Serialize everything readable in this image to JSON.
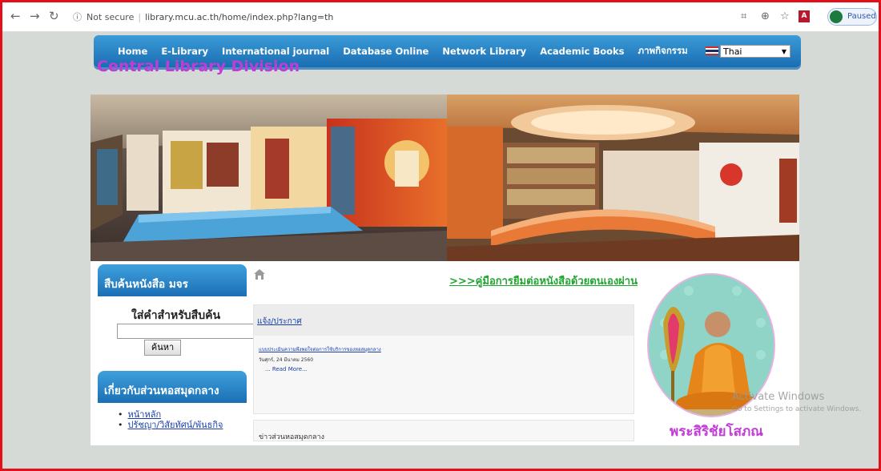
{
  "browser": {
    "url_prefix": "Not secure",
    "url": "library.mcu.ac.th/home/index.php?lang=th",
    "profile_status": "Paused"
  },
  "nav": {
    "items": [
      "Home",
      "E-Library",
      "International journal",
      "Database Online",
      "Network Library",
      "Academic Books",
      "ภาพกิจกรรม"
    ],
    "language": "Thai"
  },
  "site_title": "Central Library Division",
  "search_box": {
    "header": "สืบค้นหนังสือ มจร",
    "prompt": "ใส่คำสำหรับสืบค้น",
    "button": "ค้นหา"
  },
  "about_box": {
    "header": "เกี่ยวกับส่วนหอสมุดกลาง",
    "links": [
      "หน้าหลัก",
      "ปรัชญา/วิสัยทัศน์/พันธกิจ"
    ]
  },
  "borrow_link": ">>>คู่มือการยืมต่อหนังสือด้วยตนเองผ่าน",
  "news": {
    "title": "แจ้ง/ประกาศ",
    "item": "แบบประเมินความพึงพอใจต่อการใช้บริการของหอสมุดกลาง",
    "date": "วันศุกร์, 24 มีนาคม 2560",
    "more": "... Read More..."
  },
  "news2": {
    "title": "ข่าวส่วนหอสมุดกลาง"
  },
  "monk_name": "พระสิริชัยโสภณ",
  "watermark": {
    "line1": "Activate Windows",
    "line2": "Go to Settings to activate Windows."
  }
}
